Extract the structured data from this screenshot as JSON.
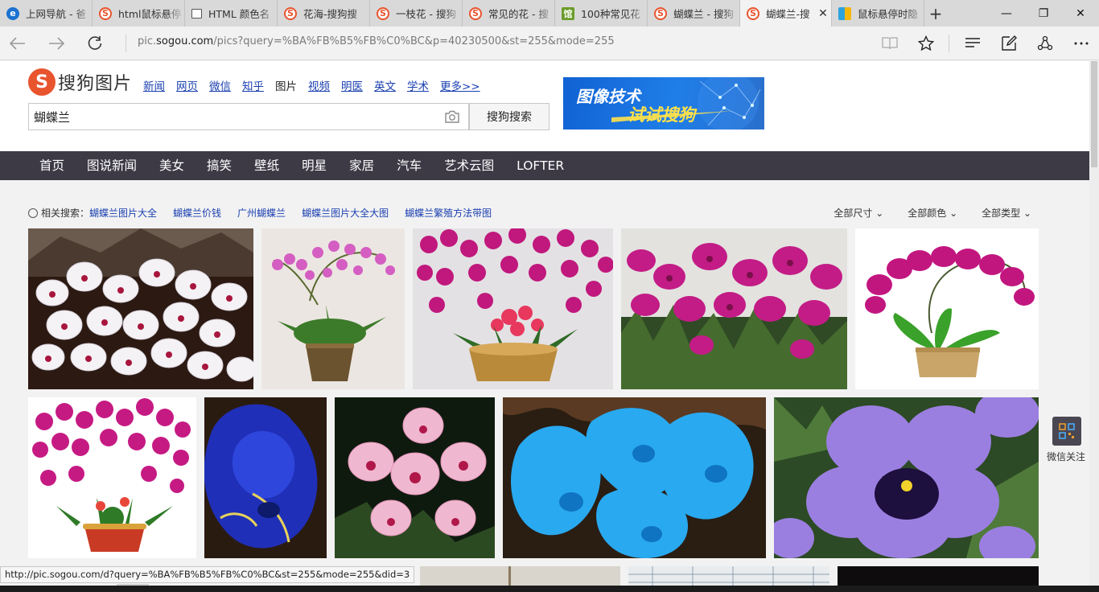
{
  "browser": {
    "tabs": [
      {
        "label": "上网导航 - 爸",
        "icon": "ie-icon",
        "active": false
      },
      {
        "label": "html鼠标悬停",
        "icon": "sogou-icon",
        "active": false
      },
      {
        "label": "HTML 颜色名",
        "icon": "page-icon",
        "active": false
      },
      {
        "label": "花海-搜狗搜",
        "icon": "sogou-icon",
        "active": false
      },
      {
        "label": "一枝花 - 搜狗",
        "icon": "sogou-icon",
        "active": false
      },
      {
        "label": "常见的花 - 搜",
        "icon": "sogou-icon",
        "active": false
      },
      {
        "label": "100种常见花",
        "icon": "guan-icon",
        "active": false
      },
      {
        "label": "蝴蝶兰 - 搜狗",
        "icon": "sogou-icon",
        "active": false
      },
      {
        "label": "蝴蝶兰-搜",
        "icon": "sogou-icon",
        "active": true
      },
      {
        "label": "鼠标悬停时隐",
        "icon": "msn-icon",
        "active": false
      }
    ],
    "new_tab": "+",
    "close_tab": "✕",
    "window_controls": {
      "minimize": "—",
      "maximize": "❐",
      "close": "✕"
    },
    "url_prefix": "pic.",
    "url_domain": "sogou.com",
    "url_rest": "/pics?query=%BA%FB%B5%FB%C0%BC&p=40230500&st=255&mode=255",
    "status_url": "http://pic.sogou.com/d?query=%BA%FB%B5%FB%C0%BC&st=255&mode=255&did=3"
  },
  "logo": {
    "mark": "S",
    "text": "搜狗图片"
  },
  "channels": [
    {
      "label": "新闻",
      "current": false
    },
    {
      "label": "网页",
      "current": false
    },
    {
      "label": "微信",
      "current": false
    },
    {
      "label": "知乎",
      "current": false
    },
    {
      "label": "图片",
      "current": true
    },
    {
      "label": "视频",
      "current": false
    },
    {
      "label": "明医",
      "current": false
    },
    {
      "label": "英文",
      "current": false
    },
    {
      "label": "学术",
      "current": false
    },
    {
      "label": "更多>>",
      "current": false
    }
  ],
  "search": {
    "value": "蝴蝶兰",
    "button": "搜狗搜索"
  },
  "banner": {
    "line1": "图像技术",
    "line2": "试试搜狗"
  },
  "categories": [
    "首页",
    "图说新闻",
    "美女",
    "搞笑",
    "壁纸",
    "明星",
    "家居",
    "汽车",
    "艺术云图",
    "LOFTER"
  ],
  "related": {
    "label": "相关搜索：",
    "items": [
      "蝴蝶兰图片大全",
      "蝴蝶兰价钱",
      "广州蝴蝶兰",
      "蝴蝶兰图片大全大图",
      "蝴蝶兰繁殖方法带图"
    ]
  },
  "filters": [
    "全部尺寸 ⌄",
    "全部颜色 ⌄",
    "全部类型 ⌄"
  ],
  "side": {
    "label": "微信关注"
  },
  "colors": {
    "brand": "#e8542e",
    "nav_bg": "#3d3a46",
    "link": "#1a3fb0",
    "banner_blue": "#1f7ee8",
    "banner_yellow": "#ffe14a"
  }
}
